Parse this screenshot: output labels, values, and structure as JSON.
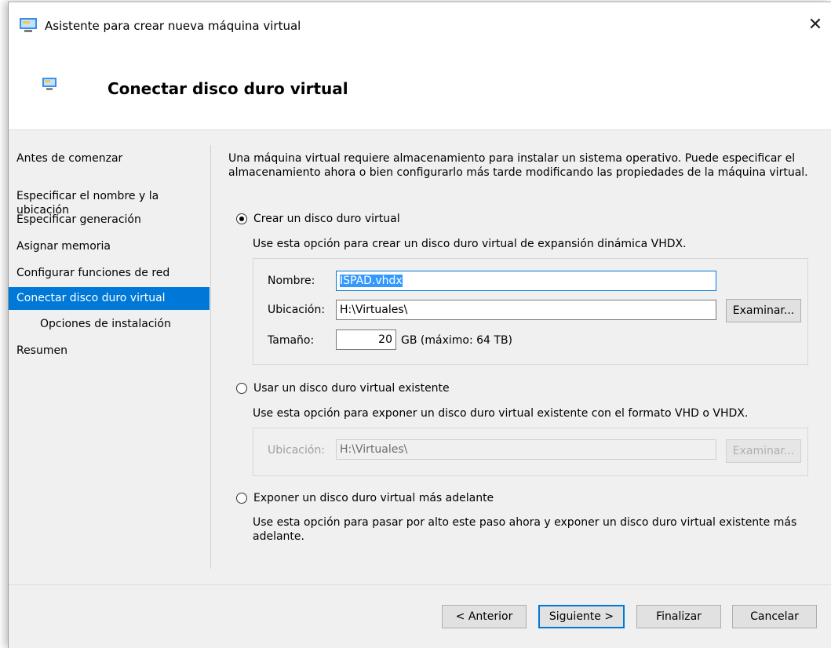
{
  "window": {
    "title": "Asistente para crear nueva máquina virtual",
    "close": "✕"
  },
  "header": {
    "title": "Conectar disco duro virtual"
  },
  "nav": {
    "items": [
      {
        "label": "Antes de comenzar"
      },
      {
        "label": "Especificar el nombre y la\nubicación"
      },
      {
        "label": "Especificar generación"
      },
      {
        "label": "Asignar memoria"
      },
      {
        "label": "Configurar funciones de red"
      },
      {
        "label": "Conectar disco duro virtual",
        "selected": true
      },
      {
        "label": "Opciones de instalación",
        "sub": true
      },
      {
        "label": "Resumen"
      }
    ]
  },
  "content": {
    "intro": "Una máquina virtual requiere almacenamiento para instalar un sistema operativo. Puede especificar el almacenamiento ahora o bien configurarlo más tarde modificando las propiedades de la máquina virtual.",
    "option_create": {
      "label": "Crear un disco duro virtual",
      "desc": "Use esta opción para crear un disco duro virtual de expansión dinámica VHDX.",
      "checked": true,
      "name_label": "Nombre:",
      "name_value": "ISPAD.vhdx",
      "location_label": "Ubicación:",
      "location_value": "H:\\Virtuales\\",
      "browse_label": "Examinar...",
      "size_label": "Tamaño:",
      "size_value": "20",
      "size_unit": "GB (máximo: 64 TB)"
    },
    "option_existing": {
      "label": "Usar un disco duro virtual existente",
      "desc": "Use esta opción para exponer un disco duro virtual existente con el formato VHD o VHDX.",
      "checked": false,
      "location_label": "Ubicación:",
      "location_value": "H:\\Virtuales\\",
      "browse_label": "Examinar..."
    },
    "option_later": {
      "label": "Exponer un disco duro virtual más adelante",
      "desc": "Use esta opción para pasar por alto este paso ahora y exponer un disco duro virtual existente más adelante.",
      "checked": false
    }
  },
  "footer": {
    "previous": "< Anterior",
    "next": "Siguiente >",
    "finish": "Finalizar",
    "cancel": "Cancelar"
  }
}
